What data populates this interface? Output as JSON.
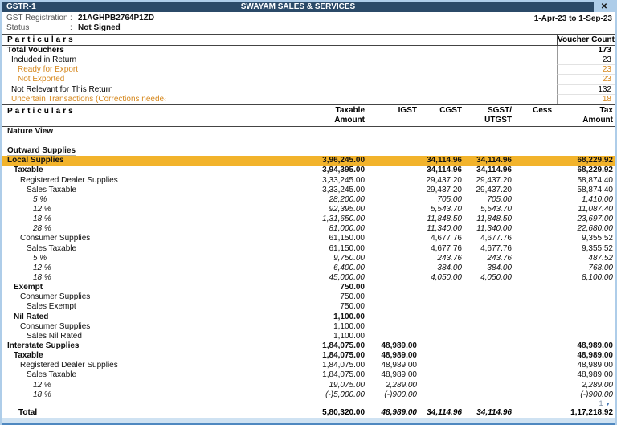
{
  "window": {
    "title": "GSTR-1",
    "company": "SWAYAM SALES & SERVICES",
    "close_glyph": "✕"
  },
  "header": {
    "gst_registration_label": "GST Registration",
    "status_label": "Status",
    "colon": ":",
    "gst_registration_value": "21AGHPB2764P1ZD",
    "status_value": "Not Signed",
    "period": "1-Apr-23 to 1-Sep-23"
  },
  "voucher_summary": {
    "particulars_header": "Particulars",
    "count_header": "Voucher Count",
    "rows": [
      {
        "label": "Total Vouchers",
        "count": "173",
        "indent": 0,
        "style": "bold"
      },
      {
        "label": "Included in Return",
        "count": "23",
        "indent": 1,
        "style": "normal"
      },
      {
        "label": "Ready for Export",
        "count": "23",
        "indent": 2,
        "style": "orange"
      },
      {
        "label": "Not Exported",
        "count": "23",
        "indent": 2,
        "style": "orange"
      },
      {
        "label": "Not Relevant for This Return",
        "count": "132",
        "indent": 1,
        "style": "normal"
      },
      {
        "label": "Uncertain Transactions (Corrections neede",
        "truncated": true,
        "count": "18",
        "indent": 1,
        "style": "orange"
      }
    ]
  },
  "main_table": {
    "particulars_header": "Particulars",
    "columns": [
      {
        "l1": "Taxable",
        "l2": "Amount"
      },
      {
        "l1": "IGST",
        "l2": ""
      },
      {
        "l1": "CGST",
        "l2": ""
      },
      {
        "l1": "SGST/",
        "l2": "UTGST"
      },
      {
        "l1": "Cess",
        "l2": ""
      },
      {
        "l1": "Tax",
        "l2": "Amount"
      }
    ],
    "rows": [
      {
        "label": "Nature View",
        "indent": 0,
        "style": "bold"
      },
      {
        "label": "",
        "indent": 0,
        "style": "normal"
      },
      {
        "label": "Outward Supplies",
        "indent": 0,
        "style": "bold",
        "underline": true
      },
      {
        "label": "Local Supplies",
        "indent": 0,
        "style": "bold",
        "highlight": true,
        "taxable": "3,96,245.00",
        "cgst": "34,114.96",
        "sgst": "34,114.96",
        "tax": "68,229.92"
      },
      {
        "label": "Taxable",
        "indent": 1,
        "style": "bold",
        "taxable": "3,94,395.00",
        "cgst": "34,114.96",
        "sgst": "34,114.96",
        "tax": "68,229.92"
      },
      {
        "label": "Registered Dealer Supplies",
        "indent": 2,
        "style": "normal",
        "taxable": "3,33,245.00",
        "cgst": "29,437.20",
        "sgst": "29,437.20",
        "tax": "58,874.40"
      },
      {
        "label": "Sales Taxable",
        "indent": 3,
        "style": "normal",
        "taxable": "3,33,245.00",
        "cgst": "29,437.20",
        "sgst": "29,437.20",
        "tax": "58,874.40"
      },
      {
        "label": "5 %",
        "indent": 4,
        "style": "italic",
        "taxable": "28,200.00",
        "cgst": "705.00",
        "sgst": "705.00",
        "tax": "1,410.00"
      },
      {
        "label": "12 %",
        "indent": 4,
        "style": "italic",
        "taxable": "92,395.00",
        "cgst": "5,543.70",
        "sgst": "5,543.70",
        "tax": "11,087.40"
      },
      {
        "label": "18 %",
        "indent": 4,
        "style": "italic",
        "taxable": "1,31,650.00",
        "cgst": "11,848.50",
        "sgst": "11,848.50",
        "tax": "23,697.00"
      },
      {
        "label": "28 %",
        "indent": 4,
        "style": "italic",
        "taxable": "81,000.00",
        "cgst": "11,340.00",
        "sgst": "11,340.00",
        "tax": "22,680.00"
      },
      {
        "label": "Consumer Supplies",
        "indent": 2,
        "style": "normal",
        "taxable": "61,150.00",
        "cgst": "4,677.76",
        "sgst": "4,677.76",
        "tax": "9,355.52"
      },
      {
        "label": "Sales Taxable",
        "indent": 3,
        "style": "normal",
        "taxable": "61,150.00",
        "cgst": "4,677.76",
        "sgst": "4,677.76",
        "tax": "9,355.52"
      },
      {
        "label": "5 %",
        "indent": 4,
        "style": "italic",
        "taxable": "9,750.00",
        "cgst": "243.76",
        "sgst": "243.76",
        "tax": "487.52"
      },
      {
        "label": "12 %",
        "indent": 4,
        "style": "italic",
        "taxable": "6,400.00",
        "cgst": "384.00",
        "sgst": "384.00",
        "tax": "768.00"
      },
      {
        "label": "18 %",
        "indent": 4,
        "style": "italic",
        "taxable": "45,000.00",
        "cgst": "4,050.00",
        "sgst": "4,050.00",
        "tax": "8,100.00"
      },
      {
        "label": "Exempt",
        "indent": 1,
        "style": "bold",
        "taxable": "750.00"
      },
      {
        "label": "Consumer Supplies",
        "indent": 2,
        "style": "normal",
        "taxable": "750.00"
      },
      {
        "label": "Sales Exempt",
        "indent": 3,
        "style": "normal",
        "taxable": "750.00"
      },
      {
        "label": "Nil Rated",
        "indent": 1,
        "style": "bold",
        "taxable": "1,100.00"
      },
      {
        "label": "Consumer Supplies",
        "indent": 2,
        "style": "normal",
        "taxable": "1,100.00"
      },
      {
        "label": "Sales Nil Rated",
        "indent": 3,
        "style": "normal",
        "taxable": "1,100.00"
      },
      {
        "label": "Interstate Supplies",
        "indent": 0,
        "style": "bold",
        "taxable": "1,84,075.00",
        "igst": "48,989.00",
        "tax": "48,989.00"
      },
      {
        "label": "Taxable",
        "indent": 1,
        "style": "bold",
        "taxable": "1,84,075.00",
        "igst": "48,989.00",
        "tax": "48,989.00"
      },
      {
        "label": "Registered Dealer Supplies",
        "indent": 2,
        "style": "normal",
        "taxable": "1,84,075.00",
        "igst": "48,989.00",
        "tax": "48,989.00"
      },
      {
        "label": "Sales Taxable",
        "indent": 3,
        "style": "normal",
        "taxable": "1,84,075.00",
        "igst": "48,989.00",
        "tax": "48,989.00"
      },
      {
        "label": "12 %",
        "indent": 4,
        "style": "italic",
        "taxable": "19,075.00",
        "igst": "2,289.00",
        "tax": "2,289.00"
      },
      {
        "label": "18 %",
        "indent": 4,
        "style": "italic",
        "taxable": "(-)5,000.00",
        "igst": "(-)900.00",
        "tax": "(-)900.00"
      }
    ]
  },
  "footer": {
    "page_indicator": "1",
    "scroll_down_glyph": "▼",
    "total": {
      "label": "Total",
      "taxable": "5,80,320.00",
      "igst": "48,989.00",
      "cgst": "34,114.96",
      "sgst": "34,114.96",
      "cess": "",
      "tax": "1,17,218.92"
    }
  }
}
